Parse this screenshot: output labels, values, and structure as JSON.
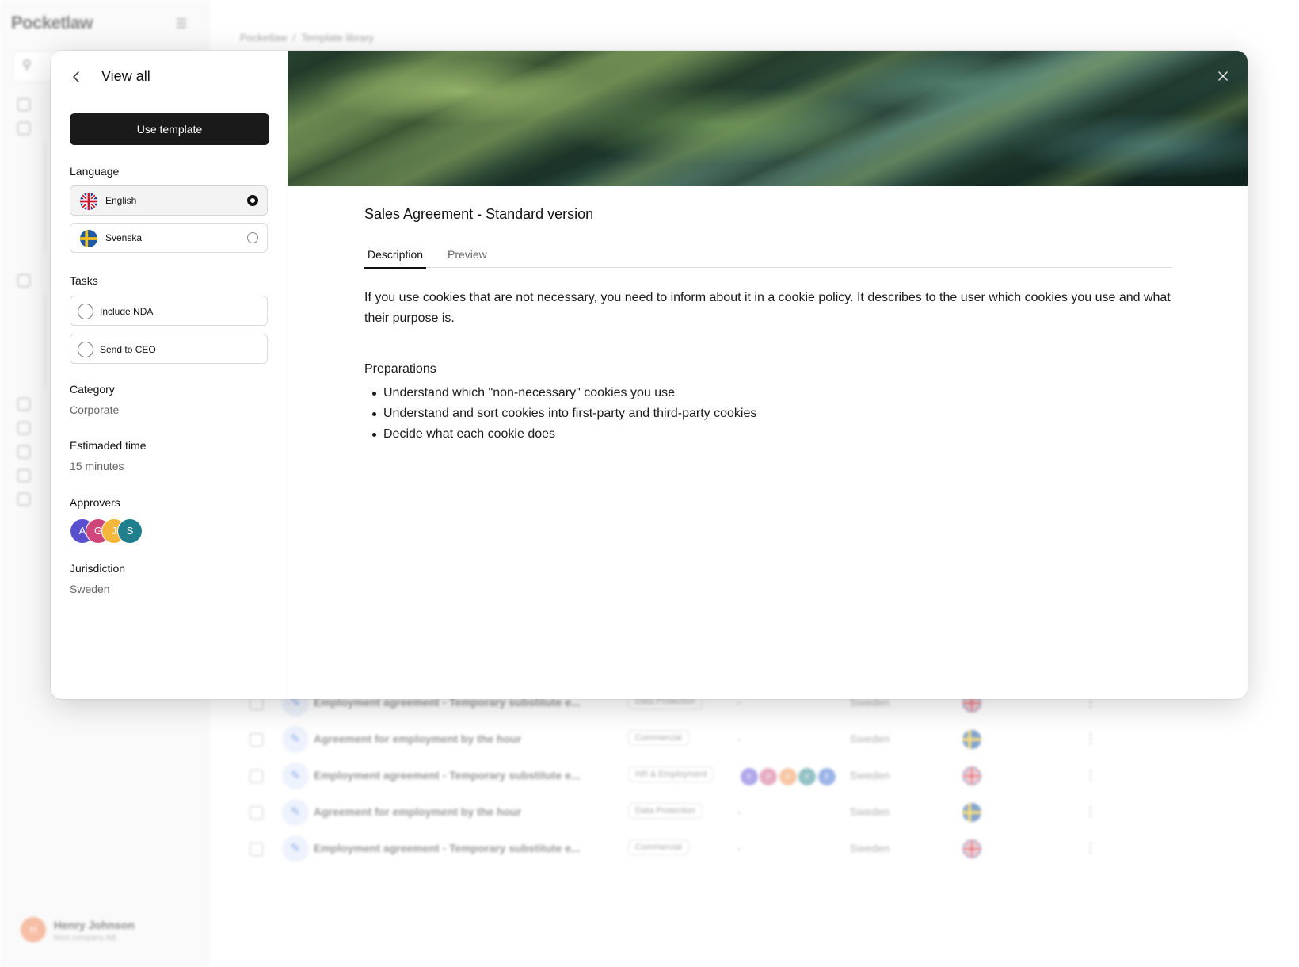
{
  "background": {
    "app_name": "Pocketlaw",
    "breadcrumb": [
      "Pocketlaw",
      "Template library"
    ],
    "user": {
      "name": "Henry Johnson",
      "company": "Nice company AB",
      "initial": "H"
    },
    "rows": [
      {
        "name": "Employment agreement - Temporary substitute e...",
        "category": "Data Protection",
        "approvers": "-",
        "country": "Sweden",
        "flag": "uk-flag"
      },
      {
        "name": "Agreement for employment by the hour",
        "category": "Commercial",
        "approvers": "-",
        "country": "Sweden",
        "flag": "sweden-flag"
      },
      {
        "name": "Employment agreement - Temporary substitute e...",
        "category": "HR & Employment",
        "approvers": "F",
        "country": "Sweden",
        "flag": "uk-flag"
      },
      {
        "name": "Agreement for employment by the hour",
        "category": "Data Protection",
        "approvers": "-",
        "country": "Sweden",
        "flag": "sweden-flag"
      },
      {
        "name": "Employment agreement - Temporary substitute e...",
        "category": "Commercial",
        "approvers": "-",
        "country": "Sweden",
        "flag": "uk-flag"
      }
    ]
  },
  "panel": {
    "back_icon": "chevron-left-icon",
    "title": "View all",
    "use_template": "Use template",
    "language": {
      "label": "Language",
      "options": [
        {
          "label": "English",
          "flag": "uk-flag",
          "selected": true
        },
        {
          "label": "Svenska",
          "flag": "sweden-flag",
          "selected": false
        }
      ]
    },
    "tasks": {
      "label": "Tasks",
      "items": [
        {
          "label": "Include NDA",
          "checked": false
        },
        {
          "label": "Send to CEO",
          "checked": false
        }
      ]
    },
    "category": {
      "label": "Category",
      "value": "Corporate"
    },
    "estimated_time": {
      "label": "Estimaded time",
      "value": "15 minutes"
    },
    "approvers": {
      "label": "Approvers",
      "people": [
        {
          "initial": "A",
          "color": "#5a4fcf"
        },
        {
          "initial": "G",
          "color": "#d0457a"
        },
        {
          "initial": "J",
          "color": "#f5b73b"
        },
        {
          "initial": "S",
          "color": "#1f7f8c"
        }
      ]
    },
    "jurisdiction": {
      "label": "Jurisdiction",
      "value": "Sweden"
    }
  },
  "main": {
    "close_icon": "close-icon",
    "title": "Sales Agreement - Standard version",
    "tabs": [
      {
        "label": "Description",
        "active": true
      },
      {
        "label": "Preview",
        "active": false
      }
    ],
    "description": "If you use cookies that are not necessary, you need to inform about it in a cookie policy. It describes to the user which cookies you use and what their purpose is.",
    "preparations_title": "Preparations",
    "preparations": [
      "Understand which \"non-necessary\" cookies you use",
      "Understand and sort cookies into first-party and third-party cookies",
      "Decide what each cookie does"
    ]
  },
  "colors": {
    "primary_button": "#1a1a1a",
    "accent_uk_blue": "#1d3d8f",
    "accent_uk_red": "#cf142b",
    "sweden_blue": "#1f5aa6",
    "sweden_yellow": "#f4c21b"
  }
}
